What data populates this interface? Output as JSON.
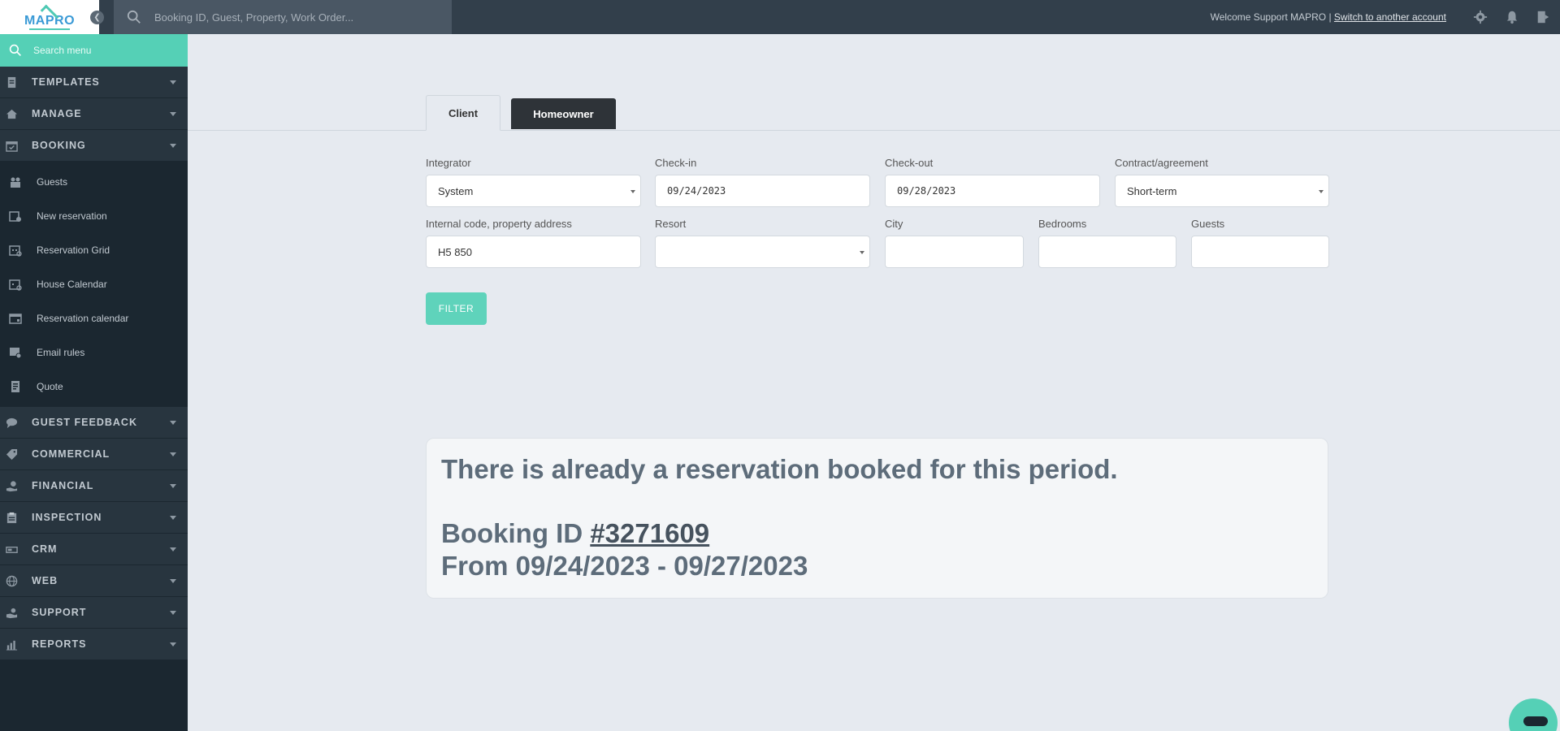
{
  "app": {
    "logo_text": "MAPRO",
    "search_placeholder": "Booking ID, Guest, Property, Work Order...",
    "welcome_text": "Welcome Support MAPRO | ",
    "switch_account_label": "Switch to another account"
  },
  "sidebar": {
    "search_placeholder": "Search menu",
    "sections_top": [
      {
        "label": "TEMPLATES",
        "icon": "document-icon"
      },
      {
        "label": "MANAGE",
        "icon": "house-icon"
      }
    ],
    "booking": {
      "label": "BOOKING",
      "icon": "calendar-check-icon",
      "items": [
        {
          "label": "Guests",
          "icon": "guests-icon"
        },
        {
          "label": "New reservation",
          "icon": "calendar-plus-icon"
        },
        {
          "label": "Reservation Grid",
          "icon": "calendar-grid-icon"
        },
        {
          "label": "House Calendar",
          "icon": "calendar-house-icon"
        },
        {
          "label": "Reservation calendar",
          "icon": "calendar-icon"
        },
        {
          "label": "Email rules",
          "icon": "email-rules-icon"
        },
        {
          "label": "Quote",
          "icon": "quote-icon"
        }
      ]
    },
    "sections_bottom": [
      {
        "label": "GUEST FEEDBACK",
        "icon": "comment-icon"
      },
      {
        "label": "COMMERCIAL",
        "icon": "tag-icon"
      },
      {
        "label": "FINANCIAL",
        "icon": "hand-coin-icon"
      },
      {
        "label": "INSPECTION",
        "icon": "clipboard-icon"
      },
      {
        "label": "CRM",
        "icon": "crm-icon"
      },
      {
        "label": "WEB",
        "icon": "globe-icon"
      },
      {
        "label": "SUPPORT",
        "icon": "support-icon"
      },
      {
        "label": "REPORTS",
        "icon": "chart-icon"
      }
    ]
  },
  "tabs": {
    "client": "Client",
    "homeowner": "Homeowner"
  },
  "form": {
    "integrator": {
      "label": "Integrator",
      "value": "System"
    },
    "checkin": {
      "label": "Check-in",
      "value": "09/24/2023"
    },
    "checkout": {
      "label": "Check-out",
      "value": "09/28/2023"
    },
    "contract": {
      "label": "Contract/agreement",
      "value": "Short-term"
    },
    "internal_code": {
      "label": "Internal code, property address",
      "value": "H5 850"
    },
    "resort": {
      "label": "Resort",
      "value": ""
    },
    "city": {
      "label": "City",
      "value": ""
    },
    "bedrooms": {
      "label": "Bedrooms",
      "value": ""
    },
    "guests": {
      "label": "Guests",
      "value": ""
    },
    "filter_label": "FILTER"
  },
  "alert": {
    "message": "There is already a reservation booked for this period.",
    "booking_prefix": "Booking ID ",
    "booking_id": "#3271609",
    "period": "From 09/24/2023 - 09/27/2023"
  },
  "colors": {
    "accent": "#55d0b6",
    "topbar": "#323f4b",
    "sidebar": "#1b2730",
    "sidebar_section": "#28353f"
  }
}
